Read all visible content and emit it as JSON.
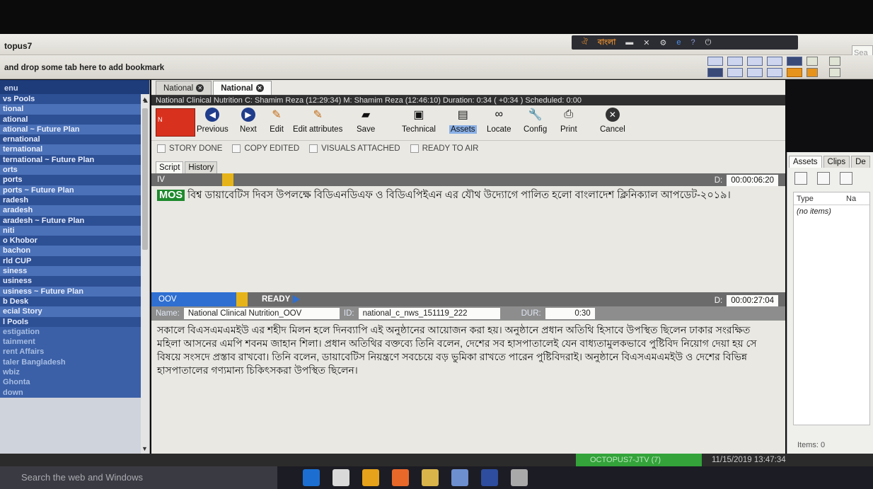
{
  "app": {
    "title": "topus7"
  },
  "tray": {
    "language": "বাংলা"
  },
  "search": {
    "placeholder": "Sea"
  },
  "bookmarks": {
    "hint": "and drop some tab here to add bookmark"
  },
  "sidebar": {
    "header": "enu",
    "items": [
      {
        "label": "vs Pools",
        "style": "dark"
      },
      {
        "label": "tional",
        "style": "light"
      },
      {
        "label": "ational",
        "style": "dark"
      },
      {
        "label": "ational ~ Future Plan",
        "style": "light"
      },
      {
        "label": "ernational",
        "style": "dark"
      },
      {
        "label": "ternational",
        "style": "light"
      },
      {
        "label": "ternational ~ Future Plan",
        "style": "dark"
      },
      {
        "label": "orts",
        "style": "light"
      },
      {
        "label": "ports",
        "style": "dark"
      },
      {
        "label": "ports ~ Future Plan",
        "style": "light"
      },
      {
        "label": "radesh",
        "style": "dark"
      },
      {
        "label": "aradesh",
        "style": "light"
      },
      {
        "label": "aradesh ~ Future Plan",
        "style": "dark"
      },
      {
        "label": "niti",
        "style": "light"
      },
      {
        "label": "o Khobor",
        "style": "dark"
      },
      {
        "label": "bachon",
        "style": "light"
      },
      {
        "label": "rld CUP",
        "style": "dark"
      },
      {
        "label": "siness",
        "style": "light"
      },
      {
        "label": "usiness",
        "style": "dark"
      },
      {
        "label": "usiness ~ Future Plan",
        "style": "light"
      },
      {
        "label": "b Desk",
        "style": "dark"
      },
      {
        "label": "ecial Story",
        "style": "light"
      },
      {
        "label": "l Pools",
        "style": "dark"
      },
      {
        "label": "estigation",
        "style": "plain"
      },
      {
        "label": "tainment",
        "style": "plain"
      },
      {
        "label": "rent Affairs",
        "style": "plain"
      },
      {
        "label": "taler Bangladesh",
        "style": "plain"
      },
      {
        "label": "wbiz",
        "style": "plain"
      },
      {
        "label": "Ghonta",
        "style": "plain"
      },
      {
        "label": "down",
        "style": "plain"
      }
    ]
  },
  "tabs": [
    {
      "label": "National"
    },
    {
      "label": "National"
    }
  ],
  "infobar": {
    "text": "National Clinical Nutrition C: Shamim Reza (12:29:34) M: Shamim Reza (12:46:10) Duration: 0:34 ( +0:34 ) Scheduled: 0:00"
  },
  "toolbar": {
    "status_box": "N",
    "previous": "Previous",
    "next": "Next",
    "edit": "Edit",
    "edit_attributes": "Edit attributes",
    "save": "Save",
    "technical": "Technical",
    "assets": "Assets",
    "locate": "Locate",
    "config": "Config",
    "print": "Print",
    "cancel": "Cancel"
  },
  "checkboxes": [
    "STORY DONE",
    "COPY EDITED",
    "VISUALS ATTACHED",
    "READY TO AIR"
  ],
  "subtabs": [
    "Script",
    "History"
  ],
  "iv_block": {
    "label": "IV",
    "dur_label": "D:",
    "dur_value": "00:00:06:20",
    "tag": "MOS",
    "text": "বিশ্ব ডায়াবেটিস দিবস উপলক্ষে বিডিএনডিএফ ও বিডিএপিইএন এর যৌথ উদ্যোগে পালিত হলো বাংলাদেশ ক্লিনিক্যাল আপডেট-২০১৯।"
  },
  "oov_block": {
    "label": "OOV",
    "status": "READY",
    "dur_label": "D:",
    "dur_value": "00:00:27:04",
    "name_label": "Name:",
    "name_value": "National Clinical Nutrition_OOV",
    "id_label": "ID:",
    "id_value": "national_c_nws_151119_222",
    "dur2_label": "DUR:",
    "dur2_value": "0:30",
    "text": "সকালে বিএসএমএমইউ এর শহীদ মিলন হলে দিনব্যাপি এই অনুষ্ঠানের আয়োজন করা হয়। অনুষ্ঠানে প্রধান অতিথি হিসাবে উপস্থিত ছিলেন ঢাকার সংরক্ষিত মহিলা আসনের এমপি শবনম জাহান শিলা। প্রধান অতিথির বক্তব্যে তিনি বলেন, দেশের সব হাসপাতালেই যেন বাধ্যতামুলকভাবে পুষ্টিবিদ নিয়োগ দেয়া হয় সে বিষয়ে সংসদে প্রস্তাব রাখবো। তিনি বলেন, ডায়াবেটিস নিয়ন্ত্রণে সবচেয়ে বড় ভুমিকা রাখতে পারেন পুষ্টিবিদরাই। অনুষ্ঠানে বিএসএমএমইউ ও দেশের বিভিন্ন হাসপাতালের গণ্যমান্য চিকিৎসকরা উপস্থিত ছিলেন।"
  },
  "assets_panel": {
    "tabs": [
      "Assets",
      "Clips",
      "De"
    ],
    "columns": [
      "Type",
      "Na"
    ],
    "empty": "(no items)",
    "count": "Items: 0"
  },
  "statusbar": {
    "server": "OCTOPUS7-JTV (7)",
    "clock": "11/15/2019 13:47:34"
  },
  "taskbar": {
    "search": "Search the web and Windows"
  }
}
